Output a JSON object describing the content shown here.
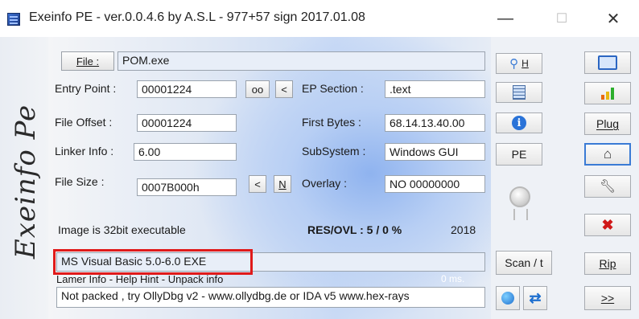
{
  "window": {
    "title": "Exeinfo PE - ver.0.0.4.6  by A.S.L -  977+57 sign  2017.01.08",
    "minimize_glyph": "—",
    "maximize_glyph": "☐",
    "close_glyph": "✕"
  },
  "logo": {
    "text": "Exeinfo Pe"
  },
  "file": {
    "button_label": "File :",
    "value": "POM.exe"
  },
  "fields": {
    "entry_point_label": "Entry Point :",
    "entry_point_value": "00001224",
    "oo_label": "oo",
    "lt1_label": "<",
    "ep_section_label": "EP Section :",
    "ep_section_value": ".text",
    "file_offset_label": "File Offset :",
    "file_offset_value": "00001224",
    "first_bytes_label": "First Bytes :",
    "first_bytes_value": "68.14.13.40.00",
    "linker_info_label": "Linker Info :",
    "linker_info_value": "6.00",
    "subsystem_label": "SubSystem :",
    "subsystem_value": "Windows GUI",
    "file_size_label": "File Size :",
    "file_size_value": "0007B000h",
    "lt2_label": "<",
    "n_label": "N",
    "overlay_label": "Overlay :",
    "overlay_value": "NO  00000000"
  },
  "status": {
    "image_info": "Image is 32bit executable",
    "res_ovl": "RES/OVL : 5 / 0 %",
    "year": "2018",
    "detection": "MS Visual Basic 5.0-6.0   EXE",
    "hint_label": "Lamer Info - Help Hint - Unpack info",
    "timing": "0 ms.",
    "hint_value": "Not packed , try OllyDbg v2 - www.ollydbg.de or IDA v5 www.hex-rays"
  },
  "middle_buttons": {
    "search_h": "H",
    "pe": "PE",
    "scan": "Scan / t"
  },
  "right_buttons": {
    "plug": "Plug",
    "rip": "Rip",
    "next": ">>"
  },
  "colors": {
    "highlight_box": "#e01a1a",
    "panel_blue": "#8fb3ef"
  }
}
